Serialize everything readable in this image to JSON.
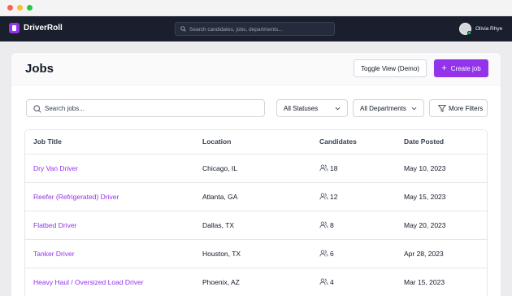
{
  "colors": {
    "accent": "#9333ea",
    "nav_bg": "#1a1f2e",
    "online": "#22c55e",
    "traffic_red": "#ff5f57",
    "traffic_yellow": "#febc2e",
    "traffic_green": "#28c840"
  },
  "app": {
    "name": "DriverRoll",
    "logo_icon": "logo-icon"
  },
  "topnav": {
    "search_placeholder": "Search candidates, jobs, departments...",
    "user_name": "Olivia Rhye"
  },
  "page": {
    "title": "Jobs",
    "toggle_label": "Toggle View (Demo)",
    "create_label": "Create job",
    "create_icon": "+"
  },
  "filters": {
    "search_placeholder": "Search jobs...",
    "status_value": "All Statuses",
    "department_value": "All Departments",
    "more_label": "More Filters"
  },
  "table": {
    "columns": [
      "Job Title",
      "Location",
      "Candidates",
      "Date Posted"
    ],
    "rows": [
      {
        "title": "Dry Van Driver",
        "location": "Chicago, IL",
        "candidates": "18",
        "date": "May 10, 2023"
      },
      {
        "title": "Reefer (Refrigerated) Driver",
        "location": "Atlanta, GA",
        "candidates": "12",
        "date": "May 15, 2023"
      },
      {
        "title": "Flatbed Driver",
        "location": "Dallas, TX",
        "candidates": "8",
        "date": "May 20, 2023"
      },
      {
        "title": "Tanker Driver",
        "location": "Houston, TX",
        "candidates": "6",
        "date": "Apr 28, 2023"
      },
      {
        "title": "Heavy Haul / Oversized Load Driver",
        "location": "Phoenix, AZ",
        "candidates": "4",
        "date": "Mar 15, 2023"
      }
    ]
  }
}
